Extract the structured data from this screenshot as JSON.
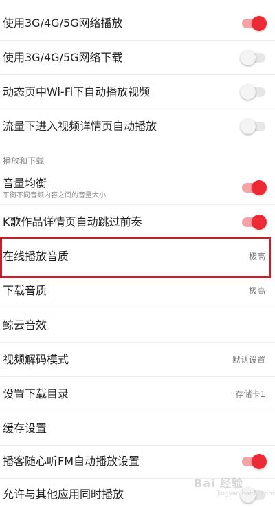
{
  "accent_color": "#ec2b36",
  "highlight_color": "#c0222b",
  "settings": [
    {
      "label": "使用3G/4G/5G网络播放",
      "toggle": "on"
    },
    {
      "label": "使用3G/4G/5G网络下载",
      "toggle": "off"
    },
    {
      "label": "动态页中Wi-Fi下自动播放视频",
      "toggle": "off"
    },
    {
      "label": "流量下进入视频详情页自动播放",
      "toggle": "off"
    }
  ],
  "section_header": "播放和下载",
  "playback": [
    {
      "label": "音量均衡",
      "sublabel": "平衡不同音频内容之间的音量大小",
      "toggle": "on"
    },
    {
      "label": "K歌作品详情页自动跳过前奏",
      "toggle": "on"
    },
    {
      "label": "在线播放音质",
      "value": "极高",
      "highlighted": true
    },
    {
      "label": "下载音质",
      "value": "极高"
    },
    {
      "label": "鲸云音效"
    },
    {
      "label": "视频解码模式",
      "value": "默认设置"
    },
    {
      "label": "设置下载目录",
      "value": "存储卡1"
    },
    {
      "label": "缓存设置"
    },
    {
      "label": "播客随心听FM自动播放设置",
      "toggle": "on"
    },
    {
      "label": "允许与其他应用同时播放",
      "toggle": "off"
    }
  ],
  "watermark": {
    "top": "Bai 经验",
    "bottom": "jingyan.baidu.com"
  }
}
